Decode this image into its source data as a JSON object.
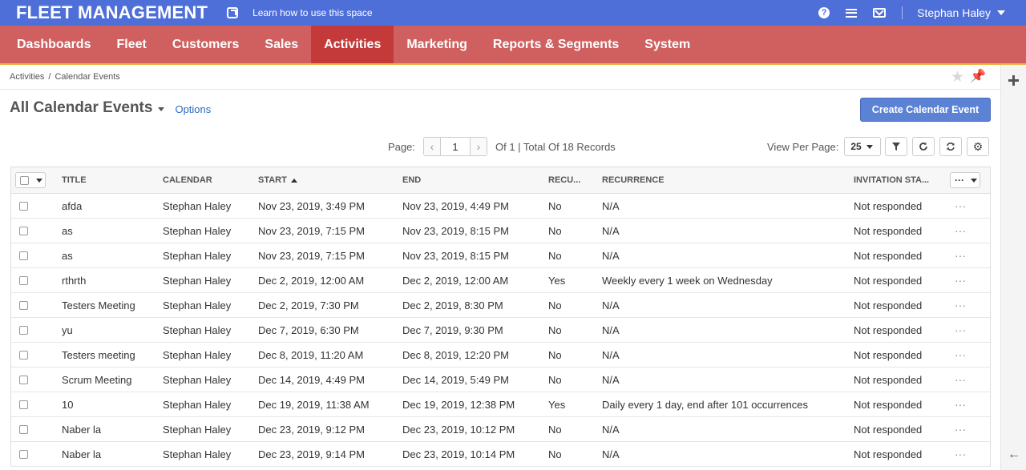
{
  "app": {
    "title": "FLEET MANAGEMENT",
    "learn_link": "Learn how to use this space"
  },
  "user": {
    "name": "Stephan Haley"
  },
  "nav": {
    "items": [
      {
        "label": "Dashboards"
      },
      {
        "label": "Fleet"
      },
      {
        "label": "Customers"
      },
      {
        "label": "Sales"
      },
      {
        "label": "Activities",
        "active": true
      },
      {
        "label": "Marketing"
      },
      {
        "label": "Reports & Segments"
      },
      {
        "label": "System"
      }
    ]
  },
  "breadcrumb": {
    "parent": "Activities",
    "separator": "/",
    "current": "Calendar Events"
  },
  "page": {
    "title": "All Calendar Events",
    "options_label": "Options",
    "create_button": "Create Calendar Event"
  },
  "pager": {
    "label": "Page:",
    "current": "1",
    "total_text": "Of 1 | Total Of 18 Records"
  },
  "view_per_page": {
    "label": "View Per Page:",
    "value": "25"
  },
  "table": {
    "columns": [
      "TITLE",
      "CALENDAR",
      "START",
      "END",
      "RECU...",
      "RECURRENCE",
      "INVITATION STA..."
    ],
    "rows": [
      [
        "afda",
        "Stephan Haley",
        "Nov 23, 2019, 3:49 PM",
        "Nov 23, 2019, 4:49 PM",
        "No",
        "N/A",
        "Not responded"
      ],
      [
        "as",
        "Stephan Haley",
        "Nov 23, 2019, 7:15 PM",
        "Nov 23, 2019, 8:15 PM",
        "No",
        "N/A",
        "Not responded"
      ],
      [
        "as",
        "Stephan Haley",
        "Nov 23, 2019, 7:15 PM",
        "Nov 23, 2019, 8:15 PM",
        "No",
        "N/A",
        "Not responded"
      ],
      [
        "rthrth",
        "Stephan Haley",
        "Dec 2, 2019, 12:00 AM",
        "Dec 2, 2019, 12:00 AM",
        "Yes",
        "Weekly every 1 week on Wednesday",
        "Not responded"
      ],
      [
        "Testers Meeting",
        "Stephan Haley",
        "Dec 2, 2019, 7:30 PM",
        "Dec 2, 2019, 8:30 PM",
        "No",
        "N/A",
        "Not responded"
      ],
      [
        "yu",
        "Stephan Haley",
        "Dec 7, 2019, 6:30 PM",
        "Dec 7, 2019, 9:30 PM",
        "No",
        "N/A",
        "Not responded"
      ],
      [
        "Testers meeting",
        "Stephan Haley",
        "Dec 8, 2019, 11:20 AM",
        "Dec 8, 2019, 12:20 PM",
        "No",
        "N/A",
        "Not responded"
      ],
      [
        "Scrum Meeting",
        "Stephan Haley",
        "Dec 14, 2019, 4:49 PM",
        "Dec 14, 2019, 5:49 PM",
        "No",
        "N/A",
        "Not responded"
      ],
      [
        "10",
        "Stephan Haley",
        "Dec 19, 2019, 11:38 AM",
        "Dec 19, 2019, 12:38 PM",
        "Yes",
        "Daily every 1 day, end after 101 occurrences",
        "Not responded"
      ],
      [
        "Naber la",
        "Stephan Haley",
        "Dec 23, 2019, 9:12 PM",
        "Dec 23, 2019, 10:12 PM",
        "No",
        "N/A",
        "Not responded"
      ],
      [
        "Naber la",
        "Stephan Haley",
        "Dec 23, 2019, 9:14 PM",
        "Dec 23, 2019, 10:14 PM",
        "No",
        "N/A",
        "Not responded"
      ]
    ]
  },
  "colors": {
    "topbar": "#4f6fd8",
    "navbar": "#d06060",
    "nav_active": "#c43a3a",
    "accent_line": "#f0b13a",
    "primary_button": "#5b82d5",
    "link": "#2c6bbf"
  },
  "icons": {
    "help": "help-icon",
    "menu": "menu-icon",
    "mail": "mail-icon",
    "star": "star-icon",
    "pin": "pin-icon",
    "filter": "filter-icon",
    "refresh": "refresh-icon",
    "reset": "reset-icon",
    "settings": "gear-icon"
  }
}
